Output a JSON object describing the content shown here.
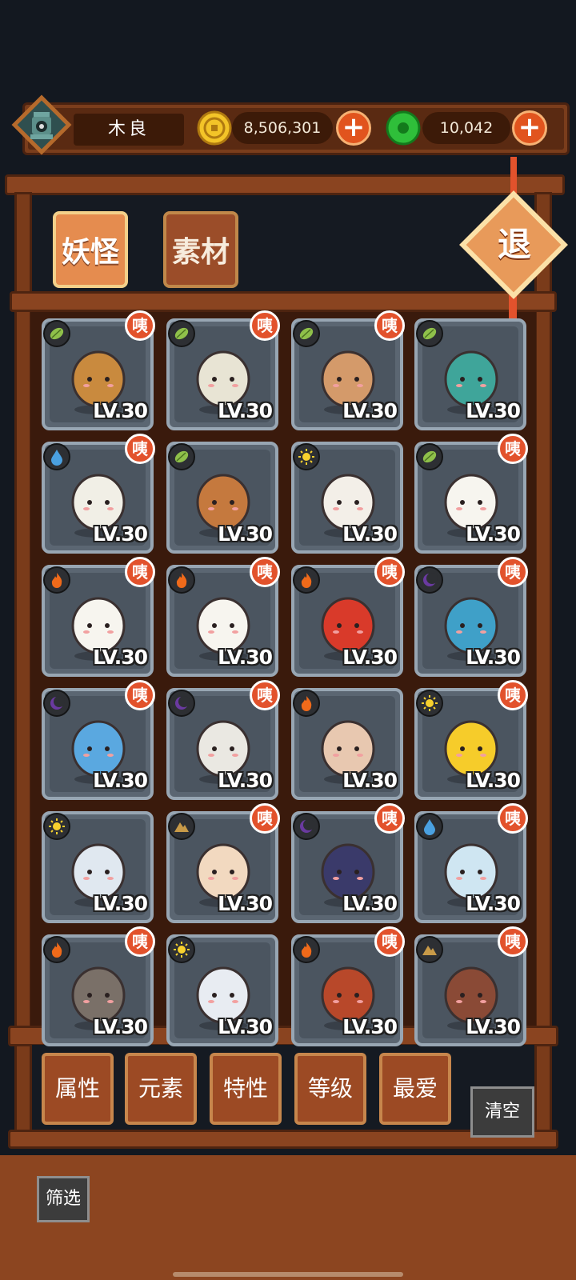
{
  "player": {
    "name": "木良"
  },
  "currency": {
    "coins": "8,506,301",
    "jade": "10,042"
  },
  "tabs": [
    {
      "label": "妖怪",
      "active": true
    },
    {
      "label": "素材",
      "active": false
    }
  ],
  "exit_label": "退",
  "card_badge": "咦",
  "monsters": [
    {
      "level": "LV.30",
      "element": "wood",
      "badge": true,
      "desc": "chestnut-hat-girl-icon"
    },
    {
      "level": "LV.30",
      "element": "wood",
      "badge": true,
      "desc": "lantern-icon"
    },
    {
      "level": "LV.30",
      "element": "wood",
      "badge": true,
      "desc": "flower-girl-icon"
    },
    {
      "level": "LV.30",
      "element": "wood",
      "badge": false,
      "desc": "snake-icon"
    },
    {
      "level": "LV.30",
      "element": "water",
      "badge": true,
      "desc": "radish-icon"
    },
    {
      "level": "LV.30",
      "element": "wood",
      "badge": false,
      "desc": "tree-stump-icon"
    },
    {
      "level": "LV.30",
      "element": "light",
      "badge": false,
      "desc": "rabbit-icon"
    },
    {
      "level": "LV.30",
      "element": "wood",
      "badge": true,
      "desc": "mahjong-six-icon"
    },
    {
      "level": "LV.30",
      "element": "fire",
      "badge": true,
      "desc": "mahjong-five-icon"
    },
    {
      "level": "LV.30",
      "element": "fire",
      "badge": true,
      "desc": "mahjong-four-icon"
    },
    {
      "level": "LV.30",
      "element": "fire",
      "badge": true,
      "desc": "drum-icon"
    },
    {
      "level": "LV.30",
      "element": "dark",
      "badge": true,
      "desc": "ninja-frog-icon"
    },
    {
      "level": "LV.30",
      "element": "dark",
      "badge": true,
      "desc": "coral-icon"
    },
    {
      "level": "LV.30",
      "element": "dark",
      "badge": true,
      "desc": "conch-icon"
    },
    {
      "level": "LV.30",
      "element": "fire",
      "badge": false,
      "desc": "boar-icon"
    },
    {
      "level": "LV.30",
      "element": "light",
      "badge": true,
      "desc": "duck-icon"
    },
    {
      "level": "LV.30",
      "element": "light",
      "badge": false,
      "desc": "fan-clown-icon"
    },
    {
      "level": "LV.30",
      "element": "earth",
      "badge": true,
      "desc": "bun-icon"
    },
    {
      "level": "LV.30",
      "element": "dark",
      "badge": true,
      "desc": "ghost-bowl-icon"
    },
    {
      "level": "LV.30",
      "element": "water",
      "badge": true,
      "desc": "cloud-ghost-icon"
    },
    {
      "level": "LV.30",
      "element": "fire",
      "badge": true,
      "desc": "stone-stove-icon"
    },
    {
      "level": "LV.30",
      "element": "light",
      "badge": false,
      "desc": "star-spirit-icon"
    },
    {
      "level": "LV.30",
      "element": "fire",
      "badge": true,
      "desc": "meatball-icon"
    },
    {
      "level": "LV.30",
      "element": "earth",
      "badge": true,
      "desc": "clay-pot-icon"
    }
  ],
  "filters": [
    "属性",
    "元素",
    "特性",
    "等级",
    "最爱"
  ],
  "clear_label": "清空",
  "filter_label": "筛选",
  "colors": {
    "wood": "#8fc04a",
    "water": "#4aa0e0",
    "fire": "#f06a1a",
    "light": "#f7d12e",
    "dark": "#6a3aa0",
    "earth": "#c89a48",
    "badge": "#e2522c",
    "plus": "#e1541e"
  }
}
